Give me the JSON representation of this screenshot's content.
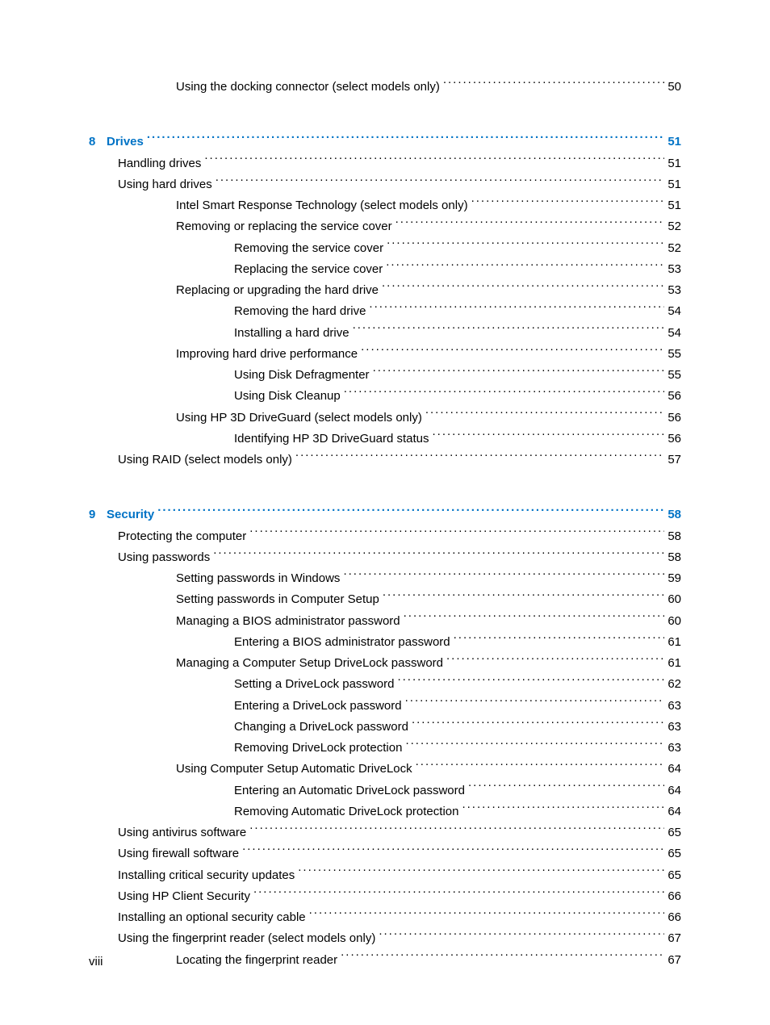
{
  "page_number": "viii",
  "orphan": {
    "title": "Using the docking connector (select models only)",
    "page": "50",
    "level": 2
  },
  "chapters": [
    {
      "num": "8",
      "title": "Drives",
      "page": "51",
      "entries": [
        {
          "title": "Handling drives",
          "page": "51",
          "level": 1
        },
        {
          "title": "Using hard drives",
          "page": "51",
          "level": 1
        },
        {
          "title": "Intel Smart Response Technology (select models only)",
          "page": "51",
          "level": 2
        },
        {
          "title": "Removing or replacing the service cover",
          "page": "52",
          "level": 2
        },
        {
          "title": "Removing the service cover",
          "page": "52",
          "level": 3
        },
        {
          "title": "Replacing the service cover",
          "page": "53",
          "level": 3
        },
        {
          "title": "Replacing or upgrading the hard drive",
          "page": "53",
          "level": 2
        },
        {
          "title": "Removing the hard drive",
          "page": "54",
          "level": 3
        },
        {
          "title": "Installing a hard drive",
          "page": "54",
          "level": 3
        },
        {
          "title": "Improving hard drive performance",
          "page": "55",
          "level": 2
        },
        {
          "title": "Using Disk Defragmenter",
          "page": "55",
          "level": 3
        },
        {
          "title": "Using Disk Cleanup",
          "page": "56",
          "level": 3
        },
        {
          "title": "Using HP 3D DriveGuard (select models only)",
          "page": "56",
          "level": 2
        },
        {
          "title": "Identifying HP 3D DriveGuard status",
          "page": "56",
          "level": 3
        },
        {
          "title": "Using RAID (select models only)",
          "page": "57",
          "level": 1
        }
      ]
    },
    {
      "num": "9",
      "title": "Security",
      "page": "58",
      "entries": [
        {
          "title": "Protecting the computer",
          "page": "58",
          "level": 1
        },
        {
          "title": "Using passwords",
          "page": "58",
          "level": 1
        },
        {
          "title": "Setting passwords in Windows",
          "page": "59",
          "level": 2
        },
        {
          "title": "Setting passwords in Computer Setup",
          "page": "60",
          "level": 2
        },
        {
          "title": "Managing a BIOS administrator password",
          "page": "60",
          "level": 2
        },
        {
          "title": "Entering a BIOS administrator password",
          "page": "61",
          "level": 3
        },
        {
          "title": "Managing a Computer Setup DriveLock password",
          "page": "61",
          "level": 2
        },
        {
          "title": "Setting a DriveLock password",
          "page": "62",
          "level": 3
        },
        {
          "title": "Entering a DriveLock password",
          "page": "63",
          "level": 3
        },
        {
          "title": "Changing a DriveLock password",
          "page": "63",
          "level": 3
        },
        {
          "title": "Removing DriveLock protection",
          "page": "63",
          "level": 3
        },
        {
          "title": "Using Computer Setup Automatic DriveLock",
          "page": "64",
          "level": 2
        },
        {
          "title": "Entering an Automatic DriveLock password",
          "page": "64",
          "level": 3
        },
        {
          "title": "Removing Automatic DriveLock protection",
          "page": "64",
          "level": 3
        },
        {
          "title": "Using antivirus software",
          "page": "65",
          "level": 1
        },
        {
          "title": "Using firewall software",
          "page": "65",
          "level": 1
        },
        {
          "title": "Installing critical security updates",
          "page": "65",
          "level": 1
        },
        {
          "title": "Using HP Client Security",
          "page": "66",
          "level": 1
        },
        {
          "title": "Installing an optional security cable",
          "page": "66",
          "level": 1
        },
        {
          "title": "Using the fingerprint reader (select models only)",
          "page": "67",
          "level": 1
        },
        {
          "title": "Locating the fingerprint reader",
          "page": "67",
          "level": 2
        }
      ]
    }
  ]
}
